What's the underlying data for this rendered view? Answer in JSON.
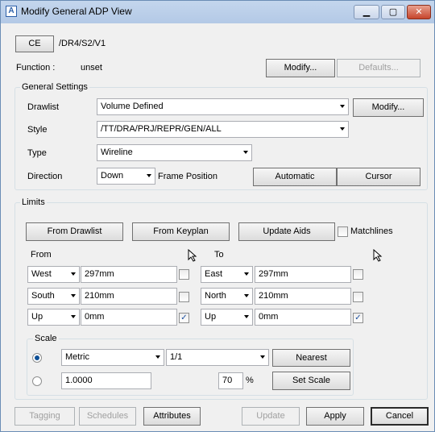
{
  "window": {
    "title": "Modify General ADP View",
    "controls": {
      "minimize": "▁",
      "maximize": "▢",
      "close": "✕"
    },
    "app_icon": "A"
  },
  "header": {
    "ce_button": "CE",
    "path": "/DR4/S2/V1",
    "function_label": "Function :",
    "function_value": "unset",
    "modify_button": "Modify...",
    "defaults_button": "Defaults..."
  },
  "general": {
    "title": "General Settings",
    "drawlist_label": "Drawlist",
    "drawlist_value": "Volume Defined",
    "drawlist_modify": "Modify...",
    "style_label": "Style",
    "style_value": "/TT/DRA/PRJ/REPR/GEN/ALL",
    "type_label": "Type",
    "type_value": "Wireline",
    "direction_label": "Direction",
    "direction_value": "Down",
    "frame_position_label": "Frame Position",
    "automatic_button": "Automatic",
    "cursor_button": "Cursor"
  },
  "limits": {
    "title": "Limits",
    "from_drawlist": "From Drawlist",
    "from_keyplan": "From Keyplan",
    "update_aids": "Update Aids",
    "matchlines": "Matchlines",
    "from_label": "From",
    "to_label": "To",
    "cursor_icon": "cursor-pick-icon",
    "from_rows": [
      {
        "dir": "West",
        "value": "297mm",
        "checked": false
      },
      {
        "dir": "South",
        "value": "210mm",
        "checked": false
      },
      {
        "dir": "Up",
        "value": "0mm",
        "checked": true
      }
    ],
    "to_rows": [
      {
        "dir": "East",
        "value": "297mm",
        "checked": false
      },
      {
        "dir": "North",
        "value": "210mm",
        "checked": false
      },
      {
        "dir": "Up",
        "value": "0mm",
        "checked": true
      }
    ],
    "scale": {
      "title": "Scale",
      "unit": "Metric",
      "ratio": "1/1",
      "nearest_button": "Nearest",
      "scale_value": "1.0000",
      "percent_value": "70",
      "percent_sign": "%",
      "set_scale_button": "Set Scale",
      "selected_option": "preset"
    }
  },
  "footer": {
    "tagging": "Tagging",
    "schedules": "Schedules",
    "attributes": "Attributes",
    "update": "Update",
    "apply": "Apply",
    "cancel": "Cancel"
  }
}
